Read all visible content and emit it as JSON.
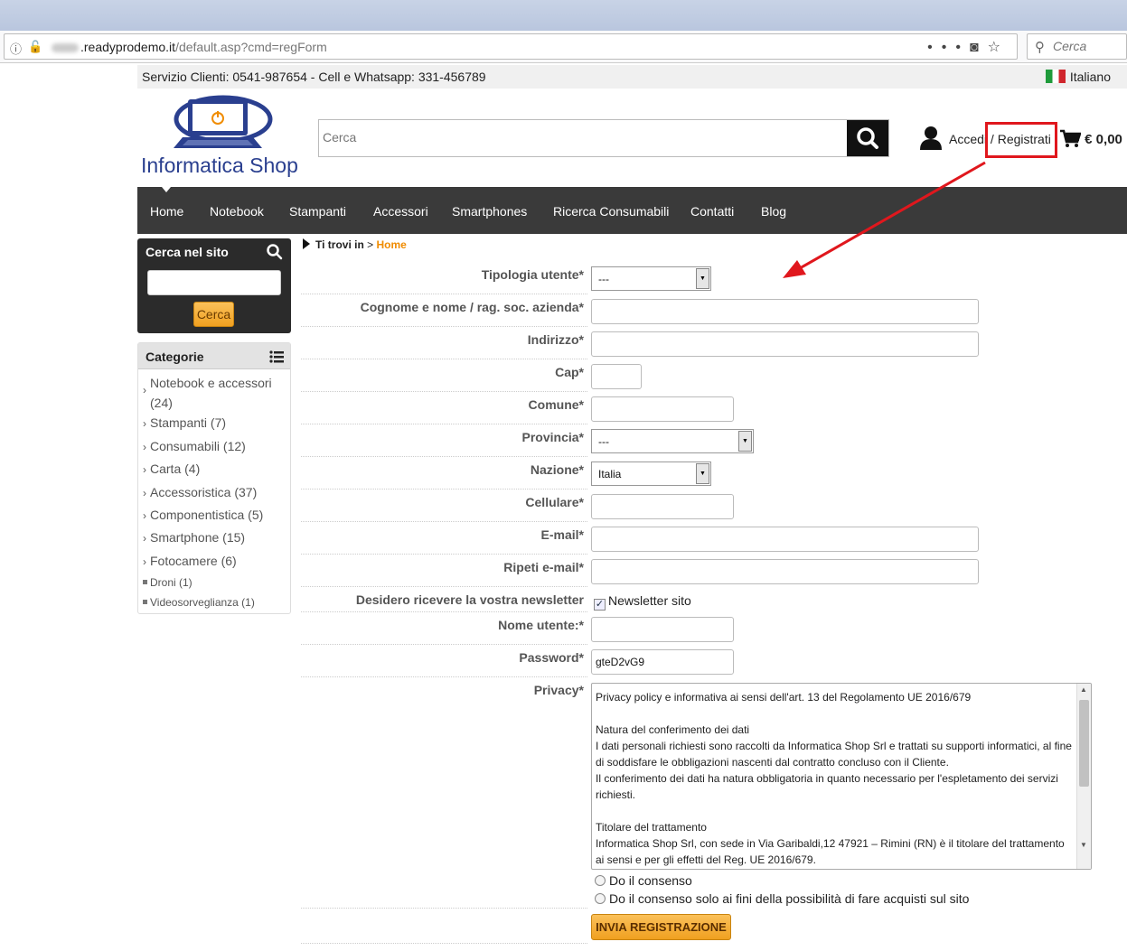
{
  "browser": {
    "url_domain": ".readyprodemo.it",
    "url_path": "/default.asp?cmd=regForm",
    "search_placeholder": "Cerca"
  },
  "topbar": {
    "service": "Servizio Clienti: 0541-987654 - Cell e Whatsapp: 331-456789",
    "language": "Italiano"
  },
  "header": {
    "logo_text": "Informatica Shop",
    "search_placeholder": "Cerca",
    "account_login": "Accedi",
    "account_sep": " / ",
    "account_register": "Registrati",
    "cart_total": "€ 0,00"
  },
  "nav": {
    "items": [
      "Home",
      "Notebook",
      "Stampanti",
      "Accessori",
      "Smartphones",
      "Ricerca Consumabili",
      "Contatti",
      "Blog"
    ]
  },
  "sidebar": {
    "search_title": "Cerca nel sito",
    "search_button": "Cerca",
    "categories_title": "Categorie",
    "categories": [
      {
        "label": "Notebook e accessori",
        "count": "(24)"
      },
      {
        "label": "Stampanti (7)"
      },
      {
        "label": "Consumabili (12)"
      },
      {
        "label": "Carta (4)"
      },
      {
        "label": "Accessoristica (37)"
      },
      {
        "label": "Componentistica (5)"
      },
      {
        "label": "Smartphone (15)"
      },
      {
        "label": "Fotocamere (6)"
      },
      {
        "label": "Droni (1)"
      },
      {
        "label": "Videosorveglianza (1)"
      }
    ]
  },
  "breadcrumb": {
    "prefix": "Ti trovi in",
    "separator": ">",
    "current": "Home"
  },
  "form": {
    "labels": {
      "tipologia": "Tipologia utente*",
      "cognome": "Cognome e nome / rag. soc. azienda*",
      "indirizzo": "Indirizzo*",
      "cap": "Cap*",
      "comune": "Comune*",
      "provincia": "Provincia*",
      "nazione": "Nazione*",
      "cellulare": "Cellulare*",
      "email": "E-mail*",
      "ripeti_email": "Ripeti e-mail*",
      "newsletter": "Desidero ricevere la vostra newsletter",
      "username": "Nome utente:*",
      "password": "Password*",
      "privacy": "Privacy*"
    },
    "values": {
      "tipologia": "---",
      "provincia": "---",
      "nazione": "Italia",
      "password": "gteD2vG9"
    },
    "newsletter_option": "Newsletter sito",
    "privacy_text": "Privacy policy e informativa ai sensi dell'art. 13 del Regolamento UE 2016/679\n\nNatura del conferimento dei dati\nI dati personali richiesti sono raccolti da Informatica Shop Srl e trattati su supporti informatici, al fine di soddisfare le obbligazioni nascenti dal contratto concluso con il Cliente.\nIl conferimento dei dati ha natura obbligatoria in quanto necessario per l'espletamento dei servizi richiesti.\n\nTitolare del trattamento\nInformatica Shop Srl, con sede in Via Garibaldi,12 47921 – Rimini (RN) è il titolare del trattamento ai sensi e per gli effetti del Reg. UE 2016/679.",
    "consent_1": "Do il consenso",
    "consent_2": "Do il consenso solo ai fini della possibilità di fare acquisti sul sito",
    "submit": "INVIA REGISTRAZIONE"
  },
  "colors": {
    "nav_bg": "#3a3a3a",
    "accent_orange": "#f0a020",
    "annotation_red": "#e0171d",
    "logo_blue": "#2a3f8f"
  }
}
